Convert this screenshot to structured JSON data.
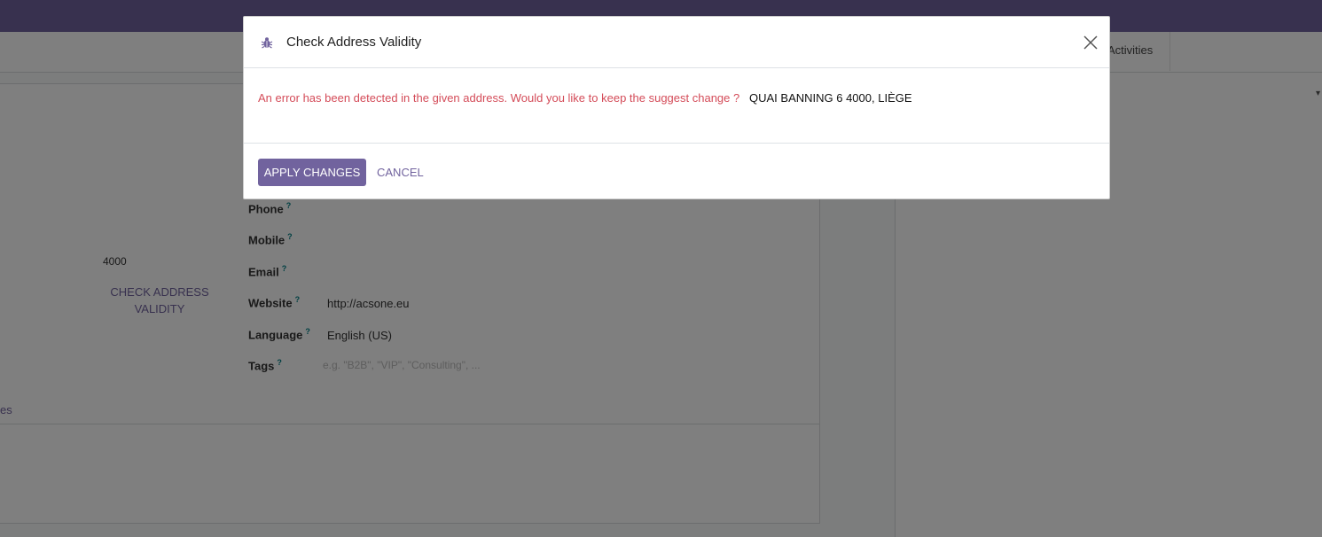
{
  "background": {
    "activities_label": "Activities",
    "zip": "4000",
    "check_address_button": "CHECK ADDRESS VALIDITY",
    "fields": [
      {
        "label": "Phone",
        "value": ""
      },
      {
        "label": "Mobile",
        "value": ""
      },
      {
        "label": "Email",
        "value": ""
      },
      {
        "label": "Website",
        "value": "http://acsone.eu"
      },
      {
        "label": "Language",
        "value": "English (US)"
      },
      {
        "label": "Tags",
        "placeholder": "e.g. \"B2B\", \"VIP\", \"Consulting\", ..."
      }
    ],
    "help_marker": "?",
    "tab_fragment": "es"
  },
  "dialog": {
    "title": "Check Address Validity",
    "message": "An error has been detected in the given address. Would you like to keep the suggest change ?",
    "suggested_address": "QUAI BANNING 6 4000, LIÈGE",
    "apply_label": "APPLY CHANGES",
    "cancel_label": "CANCEL",
    "title_icon": "bug-icon",
    "close_icon": "close-icon"
  },
  "colors": {
    "brand": "#71639e",
    "error": "#d44c59",
    "help": "#017e84"
  }
}
